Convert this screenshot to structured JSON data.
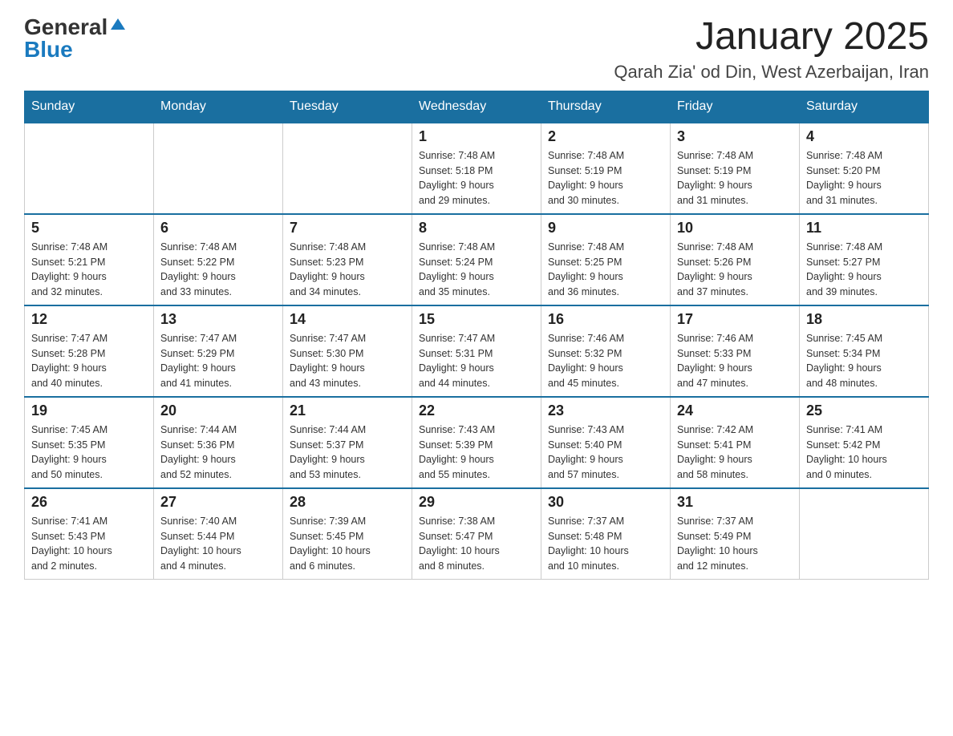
{
  "header": {
    "logo_general": "General",
    "logo_blue": "Blue",
    "month_title": "January 2025",
    "location": "Qarah Zia' od Din, West Azerbaijan, Iran"
  },
  "days_of_week": [
    "Sunday",
    "Monday",
    "Tuesday",
    "Wednesday",
    "Thursday",
    "Friday",
    "Saturday"
  ],
  "weeks": [
    [
      {
        "day": "",
        "info": ""
      },
      {
        "day": "",
        "info": ""
      },
      {
        "day": "",
        "info": ""
      },
      {
        "day": "1",
        "info": "Sunrise: 7:48 AM\nSunset: 5:18 PM\nDaylight: 9 hours\nand 29 minutes."
      },
      {
        "day": "2",
        "info": "Sunrise: 7:48 AM\nSunset: 5:19 PM\nDaylight: 9 hours\nand 30 minutes."
      },
      {
        "day": "3",
        "info": "Sunrise: 7:48 AM\nSunset: 5:19 PM\nDaylight: 9 hours\nand 31 minutes."
      },
      {
        "day": "4",
        "info": "Sunrise: 7:48 AM\nSunset: 5:20 PM\nDaylight: 9 hours\nand 31 minutes."
      }
    ],
    [
      {
        "day": "5",
        "info": "Sunrise: 7:48 AM\nSunset: 5:21 PM\nDaylight: 9 hours\nand 32 minutes."
      },
      {
        "day": "6",
        "info": "Sunrise: 7:48 AM\nSunset: 5:22 PM\nDaylight: 9 hours\nand 33 minutes."
      },
      {
        "day": "7",
        "info": "Sunrise: 7:48 AM\nSunset: 5:23 PM\nDaylight: 9 hours\nand 34 minutes."
      },
      {
        "day": "8",
        "info": "Sunrise: 7:48 AM\nSunset: 5:24 PM\nDaylight: 9 hours\nand 35 minutes."
      },
      {
        "day": "9",
        "info": "Sunrise: 7:48 AM\nSunset: 5:25 PM\nDaylight: 9 hours\nand 36 minutes."
      },
      {
        "day": "10",
        "info": "Sunrise: 7:48 AM\nSunset: 5:26 PM\nDaylight: 9 hours\nand 37 minutes."
      },
      {
        "day": "11",
        "info": "Sunrise: 7:48 AM\nSunset: 5:27 PM\nDaylight: 9 hours\nand 39 minutes."
      }
    ],
    [
      {
        "day": "12",
        "info": "Sunrise: 7:47 AM\nSunset: 5:28 PM\nDaylight: 9 hours\nand 40 minutes."
      },
      {
        "day": "13",
        "info": "Sunrise: 7:47 AM\nSunset: 5:29 PM\nDaylight: 9 hours\nand 41 minutes."
      },
      {
        "day": "14",
        "info": "Sunrise: 7:47 AM\nSunset: 5:30 PM\nDaylight: 9 hours\nand 43 minutes."
      },
      {
        "day": "15",
        "info": "Sunrise: 7:47 AM\nSunset: 5:31 PM\nDaylight: 9 hours\nand 44 minutes."
      },
      {
        "day": "16",
        "info": "Sunrise: 7:46 AM\nSunset: 5:32 PM\nDaylight: 9 hours\nand 45 minutes."
      },
      {
        "day": "17",
        "info": "Sunrise: 7:46 AM\nSunset: 5:33 PM\nDaylight: 9 hours\nand 47 minutes."
      },
      {
        "day": "18",
        "info": "Sunrise: 7:45 AM\nSunset: 5:34 PM\nDaylight: 9 hours\nand 48 minutes."
      }
    ],
    [
      {
        "day": "19",
        "info": "Sunrise: 7:45 AM\nSunset: 5:35 PM\nDaylight: 9 hours\nand 50 minutes."
      },
      {
        "day": "20",
        "info": "Sunrise: 7:44 AM\nSunset: 5:36 PM\nDaylight: 9 hours\nand 52 minutes."
      },
      {
        "day": "21",
        "info": "Sunrise: 7:44 AM\nSunset: 5:37 PM\nDaylight: 9 hours\nand 53 minutes."
      },
      {
        "day": "22",
        "info": "Sunrise: 7:43 AM\nSunset: 5:39 PM\nDaylight: 9 hours\nand 55 minutes."
      },
      {
        "day": "23",
        "info": "Sunrise: 7:43 AM\nSunset: 5:40 PM\nDaylight: 9 hours\nand 57 minutes."
      },
      {
        "day": "24",
        "info": "Sunrise: 7:42 AM\nSunset: 5:41 PM\nDaylight: 9 hours\nand 58 minutes."
      },
      {
        "day": "25",
        "info": "Sunrise: 7:41 AM\nSunset: 5:42 PM\nDaylight: 10 hours\nand 0 minutes."
      }
    ],
    [
      {
        "day": "26",
        "info": "Sunrise: 7:41 AM\nSunset: 5:43 PM\nDaylight: 10 hours\nand 2 minutes."
      },
      {
        "day": "27",
        "info": "Sunrise: 7:40 AM\nSunset: 5:44 PM\nDaylight: 10 hours\nand 4 minutes."
      },
      {
        "day": "28",
        "info": "Sunrise: 7:39 AM\nSunset: 5:45 PM\nDaylight: 10 hours\nand 6 minutes."
      },
      {
        "day": "29",
        "info": "Sunrise: 7:38 AM\nSunset: 5:47 PM\nDaylight: 10 hours\nand 8 minutes."
      },
      {
        "day": "30",
        "info": "Sunrise: 7:37 AM\nSunset: 5:48 PM\nDaylight: 10 hours\nand 10 minutes."
      },
      {
        "day": "31",
        "info": "Sunrise: 7:37 AM\nSunset: 5:49 PM\nDaylight: 10 hours\nand 12 minutes."
      },
      {
        "day": "",
        "info": ""
      }
    ]
  ]
}
